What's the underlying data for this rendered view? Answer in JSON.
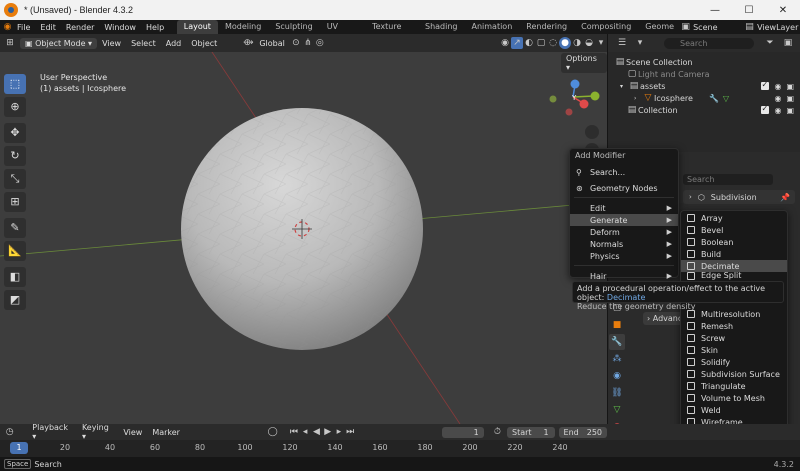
{
  "window": {
    "title": "* (Unsaved) - Blender 4.3.2",
    "controls": [
      "—",
      "☐",
      "✕"
    ]
  },
  "menu": [
    "File",
    "Edit",
    "Render",
    "Window",
    "Help"
  ],
  "workspaces": [
    "Layout",
    "Modeling",
    "Sculpting",
    "UV Editing",
    "Texture Paint",
    "Shading",
    "Animation",
    "Rendering",
    "Compositing",
    "Geome"
  ],
  "active_workspace": "Layout",
  "scene": {
    "name": "Scene",
    "view_layer": "ViewLayer"
  },
  "viewport": {
    "mode": "Object Mode",
    "menus": [
      "View",
      "Select",
      "Add",
      "Object"
    ],
    "transform": "Global",
    "options_label": "Options",
    "overlay_line1": "User Perspective",
    "overlay_line2": "(1) assets | Icosphere",
    "gizmo": {
      "x": "X",
      "y": "Y",
      "z": "Z"
    },
    "tools": [
      "select-box",
      "cursor",
      "move",
      "rotate",
      "scale",
      "transform",
      "annotate",
      "measure",
      "add-cube",
      "add-cube-2"
    ]
  },
  "outliner": {
    "search_placeholder": "Search",
    "rows": [
      {
        "label": "Scene Collection",
        "dim": false
      },
      {
        "label": "Light and Camera",
        "dim": true
      },
      {
        "label": "assets",
        "dim": false
      },
      {
        "label": "Icosphere",
        "dim": false
      },
      {
        "label": "Collection",
        "dim": false
      }
    ]
  },
  "properties": {
    "search_placeholder": "Search",
    "modifier_name": "Subdivision",
    "advanced_label": "Advance"
  },
  "add_modifier_menu": {
    "title": "Add Modifier",
    "search": "Search...",
    "geometry_nodes": "Geometry Nodes",
    "items": [
      "Edit",
      "Generate",
      "Deform",
      "Normals",
      "Physics",
      "Hair"
    ],
    "highlighted": "Generate"
  },
  "generate_submenu": {
    "items": [
      "Array",
      "Bevel",
      "Boolean",
      "Build",
      "Decimate",
      "Edge Split",
      "Multiresolution",
      "Remesh",
      "Screw",
      "Skin",
      "Solidify",
      "Subdivision Surface",
      "Triangulate",
      "Volume to Mesh",
      "Weld",
      "Wireframe"
    ],
    "highlighted": "Decimate"
  },
  "tooltip": {
    "prefix": "Add a procedural operation/effect to the active object:",
    "name": "Decimate",
    "line2": "Reduce the geometry density"
  },
  "timeline": {
    "menus": [
      "Playback",
      "Keying",
      "View",
      "Marker"
    ],
    "current_frame": "1",
    "start_label": "Start",
    "start": "1",
    "end_label": "End",
    "end": "250",
    "ticks": [
      "0",
      "20",
      "40",
      "60",
      "80",
      "100",
      "120",
      "140",
      "160",
      "180",
      "200",
      "220",
      "240"
    ]
  },
  "status": {
    "key": "Space",
    "action": "Search",
    "version": "4.3.2"
  },
  "colors": {
    "accent": "#4772b3",
    "orange": "#e87d0d",
    "link": "#71a8e3"
  }
}
